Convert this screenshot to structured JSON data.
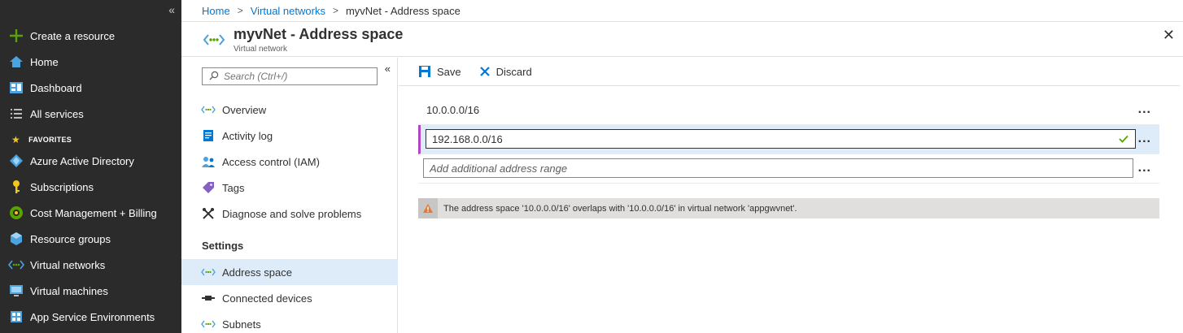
{
  "leftnav": {
    "collapse_glyph": "«",
    "items": [
      {
        "label": "Create a resource",
        "icon": "plus-icon"
      },
      {
        "label": "Home",
        "icon": "home-icon"
      },
      {
        "label": "Dashboard",
        "icon": "dashboard-icon"
      },
      {
        "label": "All services",
        "icon": "list-icon"
      }
    ],
    "favorites_label": "FAVORITES",
    "favorites": [
      {
        "label": "Azure Active Directory",
        "icon": "azure-ad-icon"
      },
      {
        "label": "Subscriptions",
        "icon": "key-icon"
      },
      {
        "label": "Cost Management + Billing",
        "icon": "cost-icon"
      },
      {
        "label": "Resource groups",
        "icon": "resource-group-icon"
      },
      {
        "label": "Virtual networks",
        "icon": "vnet-icon"
      },
      {
        "label": "Virtual machines",
        "icon": "vm-icon"
      },
      {
        "label": "App Service Environments",
        "icon": "app-service-icon"
      }
    ]
  },
  "breadcrumb": {
    "home": "Home",
    "vnets": "Virtual networks",
    "current": "myvNet - Address space"
  },
  "blade": {
    "title": "myvNet - Address space",
    "subtitle": "Virtual network",
    "close_glyph": "✕"
  },
  "resmenu": {
    "search_placeholder": "Search (Ctrl+/)",
    "collapse_glyph": "«",
    "items": [
      {
        "label": "Overview",
        "icon": "vnet-icon"
      },
      {
        "label": "Activity log",
        "icon": "activity-log-icon"
      },
      {
        "label": "Access control (IAM)",
        "icon": "iam-icon"
      },
      {
        "label": "Tags",
        "icon": "tag-icon"
      },
      {
        "label": "Diagnose and solve problems",
        "icon": "wrench-icon"
      }
    ],
    "section_settings": "Settings",
    "settings_items": [
      {
        "label": "Address space",
        "icon": "vnet-icon",
        "active": true
      },
      {
        "label": "Connected devices",
        "icon": "plug-icon"
      },
      {
        "label": "Subnets",
        "icon": "vnet-icon"
      }
    ]
  },
  "toolbar": {
    "save_label": "Save",
    "discard_label": "Discard"
  },
  "address_space": {
    "existing": "10.0.0.0/16",
    "editing_value": "192.168.0.0/16",
    "add_placeholder": "Add additional address range",
    "more_glyph": "..."
  },
  "warning": {
    "text": "The address space '10.0.0.0/16' overlaps with '10.0.0.0/16' in virtual network 'appgwvnet'."
  },
  "colors": {
    "nav_bg": "#2b2b2b",
    "link": "#0078d4",
    "active_bg": "#deecf9",
    "selected_bar": "#b146c2",
    "warning_bg": "#e1dfdd",
    "warning_icon": "#e07b39",
    "valid_check": "#57a300"
  }
}
